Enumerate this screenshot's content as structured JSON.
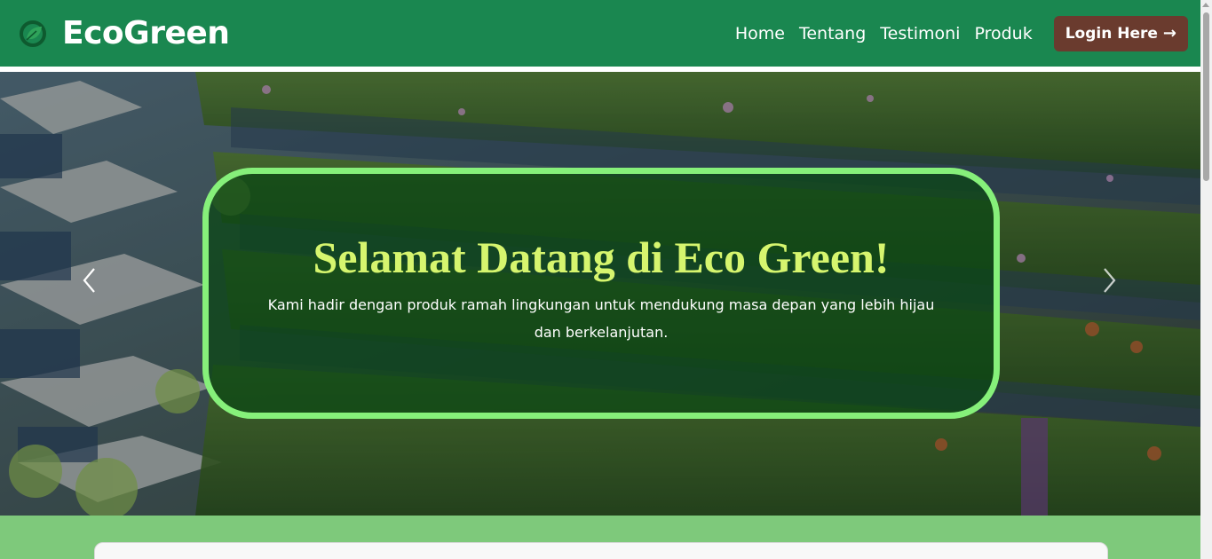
{
  "navbar": {
    "brand_name": "EcoGreen",
    "brand_icon": "leaf-logo-icon",
    "links": [
      {
        "label": "Home"
      },
      {
        "label": "Tentang"
      },
      {
        "label": "Testimoni"
      },
      {
        "label": "Produk"
      }
    ],
    "login_label": "Login Here",
    "login_icon": "arrow-right-icon"
  },
  "hero": {
    "title": "Selamat Datang di Eco Green!",
    "text": "Kami hadir dengan produk ramah lingkungan untuk mendukung masa depan yang lebih hijau dan berkelanjutan.",
    "prev_icon": "chevron-left-icon",
    "next_icon": "chevron-right-icon"
  },
  "colors": {
    "navbar_bg": "#1a8750",
    "login_bg": "#6a3b2e",
    "caption_border": "#86f07a",
    "caption_title": "#d6f56e",
    "section_bg": "#7ec97b"
  }
}
